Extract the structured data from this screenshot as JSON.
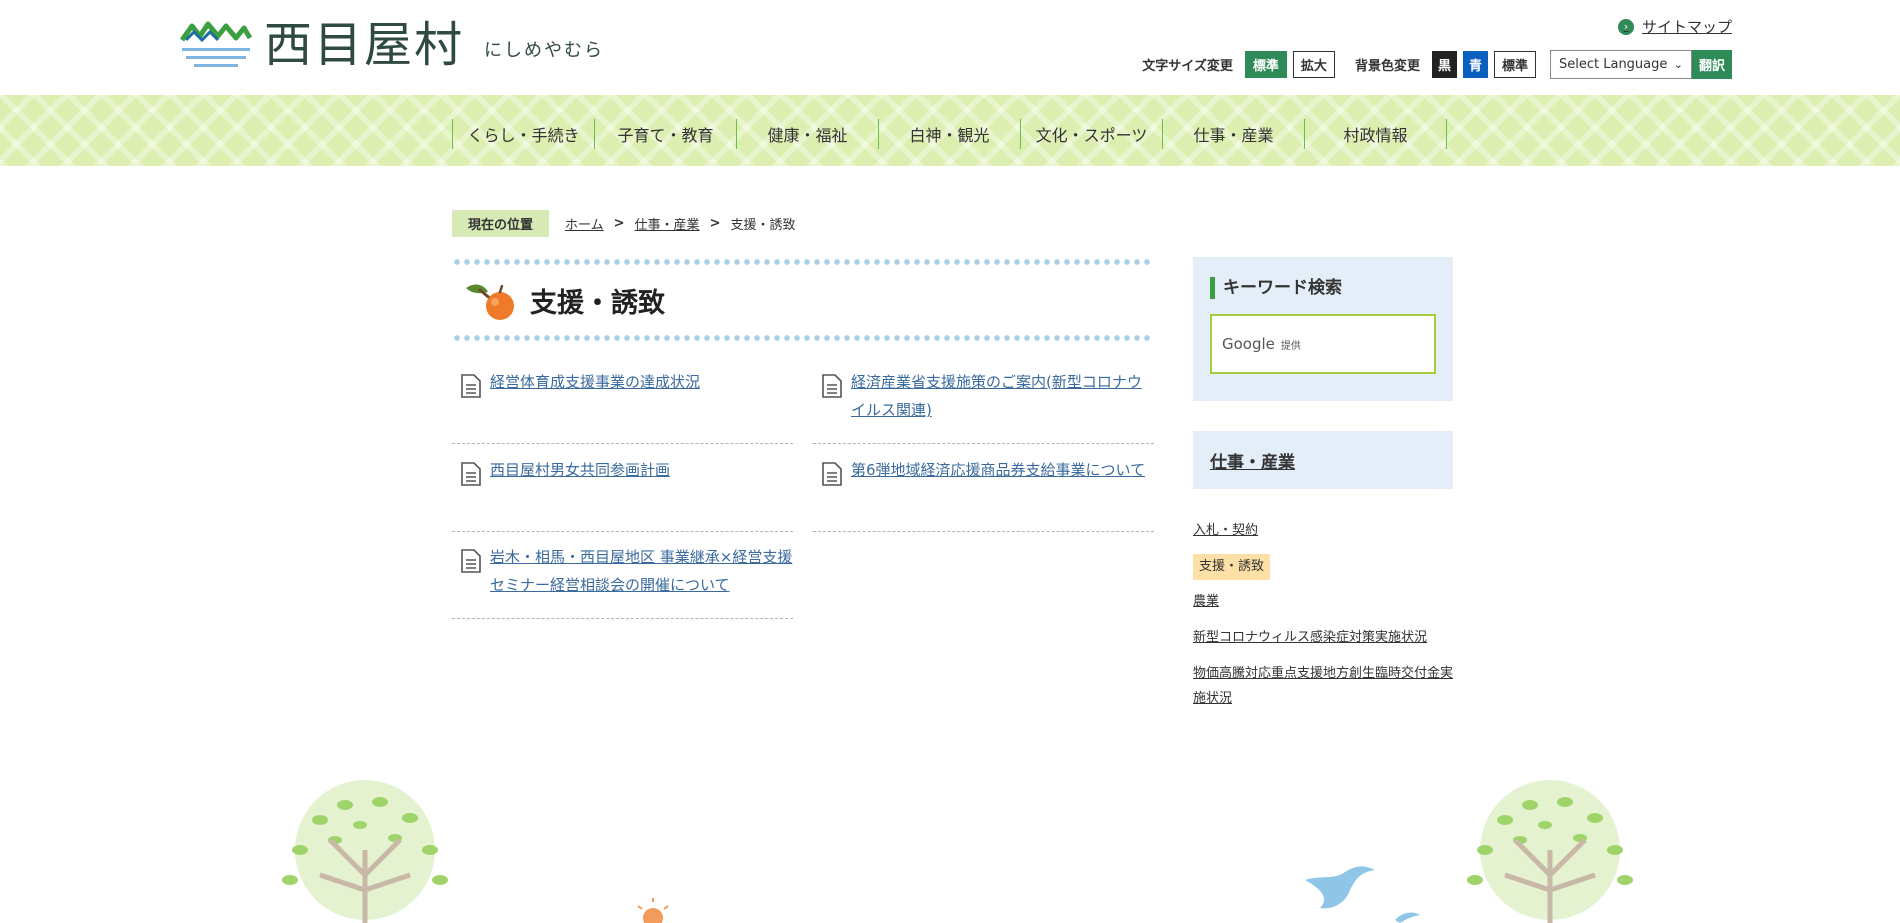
{
  "header": {
    "logo_name": "西目屋村",
    "logo_kana": "にしめやむら",
    "sitemap": "サイトマップ",
    "font_size_label": "文字サイズ変更",
    "font_size_normal": "標準",
    "font_size_large": "拡大",
    "bg_color_label": "背景色変更",
    "bg_black": "黒",
    "bg_blue": "青",
    "bg_normal": "標準",
    "language_select": "Select Language",
    "translate": "翻訳"
  },
  "nav": {
    "items": [
      "くらし・手続き",
      "子育て・教育",
      "健康・福祉",
      "白神・観光",
      "文化・スポーツ",
      "仕事・産業",
      "村政情報"
    ]
  },
  "breadcrumb": {
    "label": "現在の位置",
    "home": "ホーム",
    "parent": "仕事・産業",
    "current": "支援・誘致",
    "sep": ">"
  },
  "page": {
    "title": "支援・誘致",
    "items": [
      "経営体育成支援事業の達成状況",
      "経済産業省支援施策のご案内(新型コロナウイルス関連)",
      "西目屋村男女共同参画計画",
      "第6弾地域経済応援商品券支給事業について",
      "岩木・相馬・西目屋地区 事業継承×経営支援セミナー経営相談会の開催について"
    ]
  },
  "sidebar": {
    "search_title": "キーワード検索",
    "search_brand": "Google",
    "search_provided": "提供",
    "category": "仕事・産業",
    "links": [
      "入札・契約",
      "支援・誘致",
      "農業",
      "新型コロナウィルス感染症対策実施状況",
      "物価高騰対応重点支援地方創生臨時交付金実施状況"
    ]
  },
  "colors": {
    "brand_green": "#2e8a57",
    "nav_bg": "#dceeb0",
    "link_blue": "#3a6a9e",
    "sidebar_bg": "#e3eef8",
    "active_bg": "#fde0a6"
  }
}
